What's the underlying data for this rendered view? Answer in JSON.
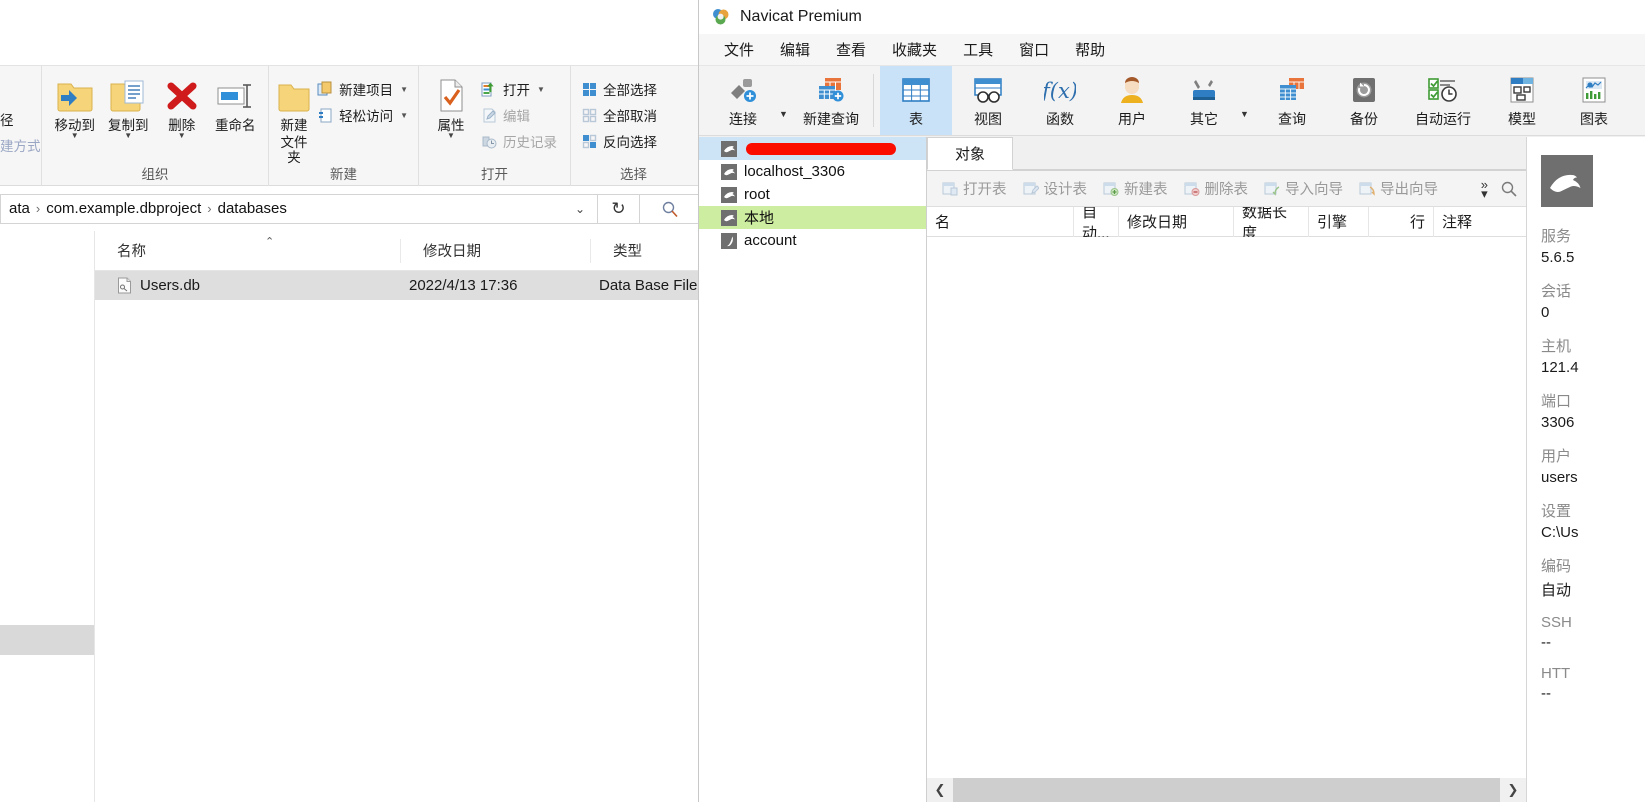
{
  "explorer": {
    "ribbon": {
      "cut_group_items": [
        {
          "label": "径",
          "dim": false
        },
        {
          "label": "建方式",
          "dim": true
        }
      ],
      "groups": [
        {
          "title": "组织",
          "big_buttons": [
            {
              "label": "移动到",
              "icon": "folder-move-icon",
              "caret": true
            },
            {
              "label": "复制到",
              "icon": "folder-copy-icon",
              "caret": true
            },
            {
              "label": "删除",
              "icon": "delete-x-icon",
              "caret": true
            },
            {
              "label": "重命名",
              "icon": "rename-icon",
              "caret": false
            }
          ]
        },
        {
          "title": "新建",
          "big_buttons": [
            {
              "label": "新建\n文件夹",
              "icon": "new-folder-icon",
              "caret": false
            }
          ],
          "small_buttons": [
            {
              "label": "新建项目",
              "icon": "new-item-icon",
              "caret": true,
              "dim": false
            },
            {
              "label": "轻松访问",
              "icon": "easy-access-icon",
              "caret": true,
              "dim": false
            }
          ]
        },
        {
          "title": "打开",
          "big_buttons": [
            {
              "label": "属性",
              "icon": "properties-icon",
              "caret": true
            }
          ],
          "small_buttons": [
            {
              "label": "打开",
              "icon": "open-icon",
              "caret": true,
              "dim": false
            },
            {
              "label": "编辑",
              "icon": "edit-icon",
              "caret": false,
              "dim": true
            },
            {
              "label": "历史记录",
              "icon": "history-icon",
              "caret": false,
              "dim": true
            }
          ]
        },
        {
          "title": "选择",
          "small_buttons": [
            {
              "label": "全部选择",
              "icon": "select-all-icon",
              "caret": false,
              "dim": false
            },
            {
              "label": "全部取消",
              "icon": "select-none-icon",
              "caret": false,
              "dim": false
            },
            {
              "label": "反向选择",
              "icon": "invert-selection-icon",
              "caret": false,
              "dim": false
            }
          ]
        }
      ]
    },
    "address": {
      "crumbs": [
        "ata",
        "com.example.dbproject",
        "databases"
      ],
      "separator": "›",
      "refresh_icon": "refresh-icon",
      "search_icon": "search-icon"
    },
    "columns": [
      "名称",
      "修改日期",
      "类型"
    ],
    "rows": [
      {
        "name": "Users.db",
        "modified": "2022/4/13 17:36",
        "type": "Data Base File",
        "icon": "db-file-icon"
      }
    ]
  },
  "navicat": {
    "title": "Navicat Premium",
    "app_icon": "navicat-logo-icon",
    "menu": [
      "文件",
      "编辑",
      "查看",
      "收藏夹",
      "工具",
      "窗口",
      "帮助"
    ],
    "toolbar": [
      {
        "label": "连接",
        "icon": "connection-icon",
        "caret": true,
        "selected": false
      },
      {
        "label": "新建查询",
        "icon": "new-query-icon",
        "caret": false,
        "selected": false
      },
      {
        "label": "表",
        "icon": "table-icon",
        "caret": false,
        "selected": true
      },
      {
        "label": "视图",
        "icon": "view-icon",
        "caret": false,
        "selected": false
      },
      {
        "label": "函数",
        "icon": "function-icon",
        "caret": false,
        "selected": false
      },
      {
        "label": "用户",
        "icon": "user-icon",
        "caret": false,
        "selected": false
      },
      {
        "label": "其它",
        "icon": "others-icon",
        "caret": true,
        "selected": false
      },
      {
        "label": "查询",
        "icon": "query-icon",
        "caret": false,
        "selected": false
      },
      {
        "label": "备份",
        "icon": "backup-icon",
        "caret": false,
        "selected": false
      },
      {
        "label": "自动运行",
        "icon": "automation-icon",
        "caret": false,
        "selected": false
      },
      {
        "label": "模型",
        "icon": "model-icon",
        "caret": false,
        "selected": false
      },
      {
        "label": "图表",
        "icon": "chart-icon",
        "caret": false,
        "selected": false
      }
    ],
    "connections": [
      {
        "label": "",
        "icon": "mysql-dolphin-icon",
        "state": "selected-blue",
        "redacted": true
      },
      {
        "label": "localhost_3306",
        "icon": "mysql-dolphin-icon",
        "state": "normal",
        "redacted": false
      },
      {
        "label": "root",
        "icon": "mysql-dolphin-icon",
        "state": "normal",
        "redacted": false
      },
      {
        "label": "本地",
        "icon": "mysql-dolphin-icon",
        "state": "selected-green",
        "redacted": false
      },
      {
        "label": "account",
        "icon": "sqlite-feather-icon",
        "state": "normal",
        "redacted": false
      }
    ],
    "tabs": [
      {
        "label": "对象",
        "active": true
      }
    ],
    "object_toolbar": [
      {
        "label": "打开表",
        "icon": "open-table-icon"
      },
      {
        "label": "设计表",
        "icon": "design-table-icon"
      },
      {
        "label": "新建表",
        "icon": "new-table-icon"
      },
      {
        "label": "删除表",
        "icon": "delete-table-icon"
      },
      {
        "label": "导入向导",
        "icon": "import-wizard-icon"
      },
      {
        "label": "导出向导",
        "icon": "export-wizard-icon"
      }
    ],
    "object_toolbar_overflow_icon": "chevron-double-right-icon",
    "object_toolbar_search_icon": "search-icon",
    "grid_columns": [
      "名",
      "自动...",
      "修改日期",
      "数据长度",
      "引擎",
      "行",
      "注释"
    ],
    "grid_rows": [],
    "scroll_left_icon": "chevron-left-icon",
    "scroll_right_icon": "chevron-right-icon",
    "info_panel": {
      "logo_icon": "mysql-dolphin-icon",
      "fields": [
        {
          "key": "服务",
          "value": "5.6.5"
        },
        {
          "key": "会话",
          "value": "0"
        },
        {
          "key": "主机",
          "value": "121.4"
        },
        {
          "key": "端口",
          "value": "3306"
        },
        {
          "key": "用户",
          "value": "users"
        },
        {
          "key": "设置",
          "value": "C:\\Us"
        },
        {
          "key": "编码",
          "value": "自动"
        },
        {
          "key": "SSH",
          "value": "--"
        },
        {
          "key": "HTT",
          "value": "--"
        }
      ]
    }
  },
  "colors": {
    "accent_blue": "#2f7ec4",
    "selection_blue": "#cde4f7",
    "selection_green": "#cdeda0",
    "redaction_red": "#fb0d00",
    "toolbar_bg": "#f3f3f3"
  }
}
